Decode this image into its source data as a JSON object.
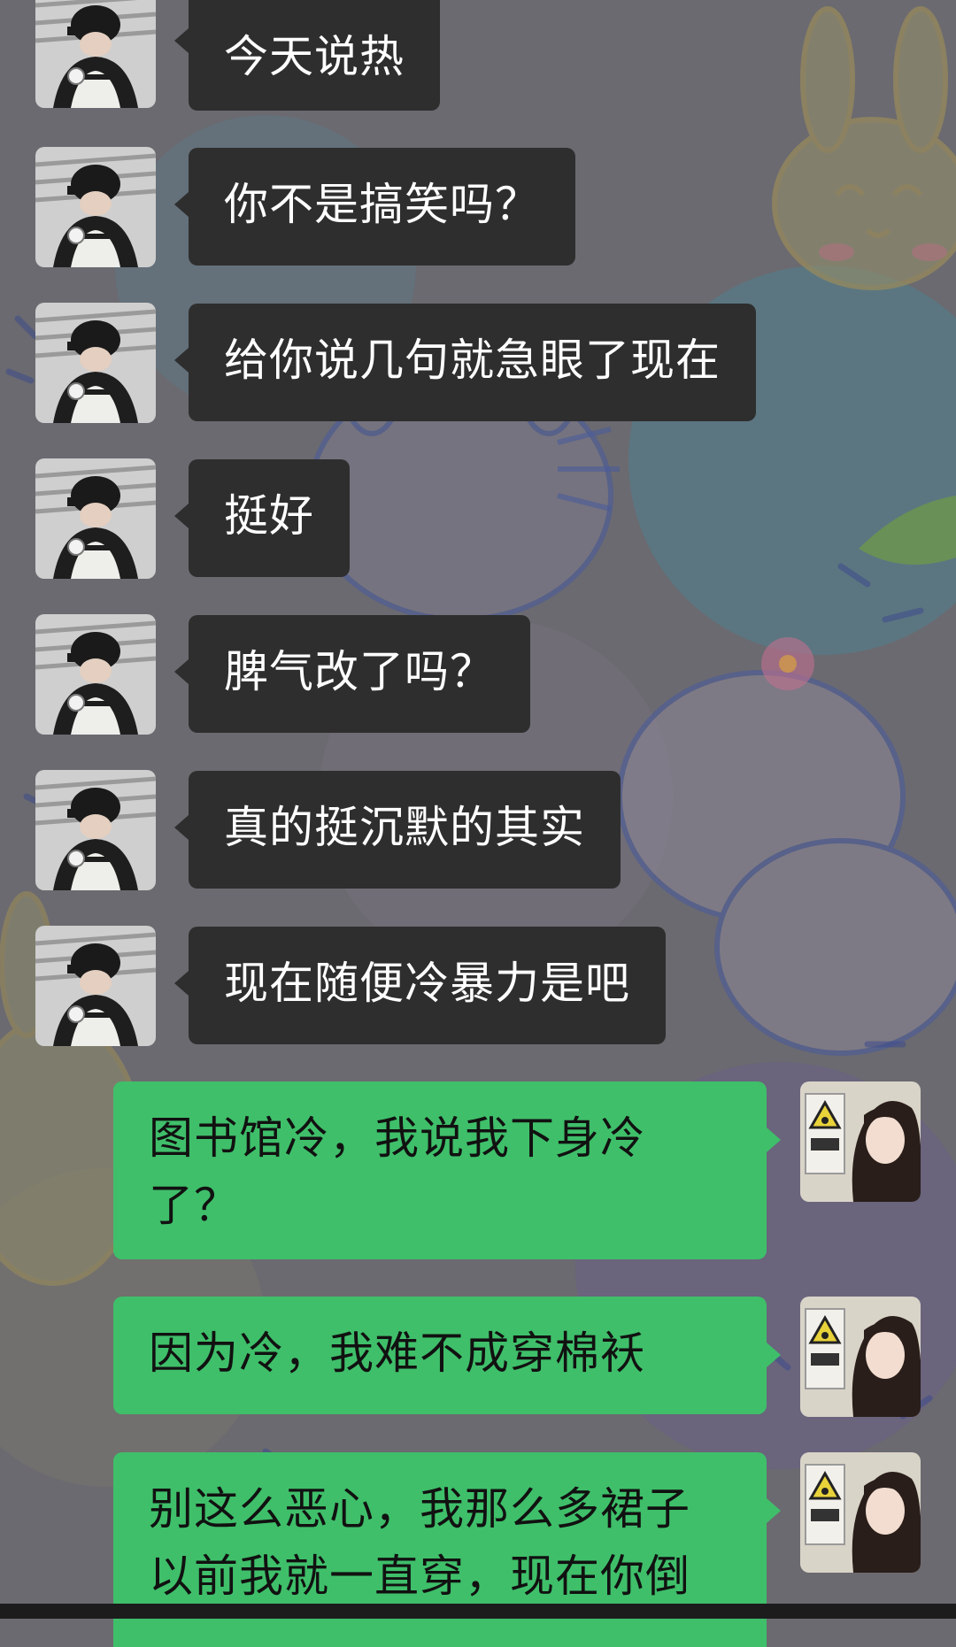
{
  "background": {
    "color": "#6b6a70",
    "pattern": "cartoon-bunny-wallpaper"
  },
  "colors": {
    "incoming_bubble": "#2e2e2e",
    "outgoing_bubble": "#3fbf6a",
    "incoming_text": "#ffffff",
    "outgoing_text": "#111111"
  },
  "messages": [
    {
      "direction": "incoming",
      "avatar": "user-avatar-black-cap",
      "text": "今天说热"
    },
    {
      "direction": "incoming",
      "avatar": "user-avatar-black-cap",
      "text": "你不是搞笑吗？"
    },
    {
      "direction": "incoming",
      "avatar": "user-avatar-black-cap",
      "text": "给你说几句就急眼了现在"
    },
    {
      "direction": "incoming",
      "avatar": "user-avatar-black-cap",
      "text": "挺好"
    },
    {
      "direction": "incoming",
      "avatar": "user-avatar-black-cap",
      "text": "脾气改了吗？"
    },
    {
      "direction": "incoming",
      "avatar": "user-avatar-black-cap",
      "text": "真的挺沉默的其实"
    },
    {
      "direction": "incoming",
      "avatar": "user-avatar-black-cap",
      "text": "现在随便冷暴力是吧"
    },
    {
      "direction": "outgoing",
      "avatar": "self-avatar-long-hair",
      "text": "图书馆冷，我说我下身冷了？"
    },
    {
      "direction": "outgoing",
      "avatar": "self-avatar-long-hair",
      "text": "因为冷，我难不成穿棉袄"
    },
    {
      "direction": "outgoing",
      "avatar": "self-avatar-long-hair",
      "text": "别这么恶心，我那么多裙子以前我就一直穿，现在你倒"
    }
  ]
}
